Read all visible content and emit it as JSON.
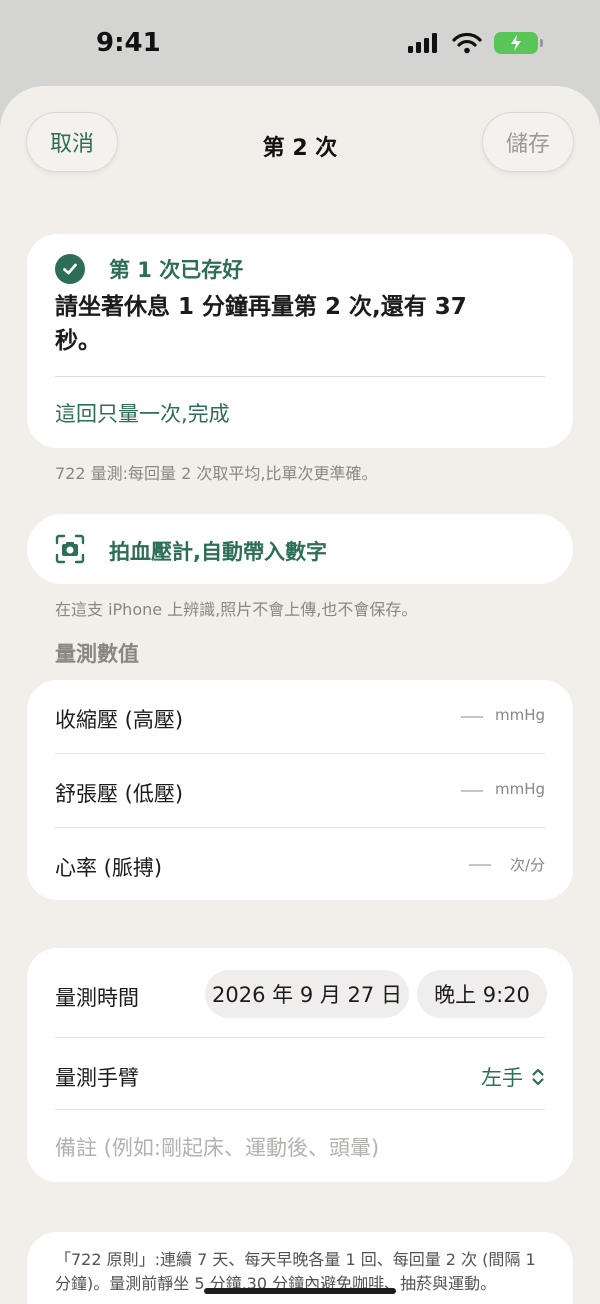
{
  "status_bar": {
    "time": "9:41",
    "icons": [
      "cellular-signal-icon",
      "wifi-icon",
      "battery-charging-icon"
    ]
  },
  "nav": {
    "cancel_label": "取消",
    "title": "第 2 次",
    "save_label": "儲存"
  },
  "saved_card": {
    "status_label": "第 1 次已存好",
    "message": "請坐著休息 1 分鐘再量第 2 次,還有 37 秒。",
    "single_measure_link": "這回只量一次,完成"
  },
  "hint_722": "722 量測:每回量 2 次取平均,比單次更準確。",
  "camera": {
    "label": "拍血壓計,自動帶入數字",
    "hint": "在這支 iPhone 上辨識,照片不會上傳,也不會保存。"
  },
  "values_section": {
    "heading": "量測數值",
    "rows": [
      {
        "label": "收縮壓 (高壓)",
        "value": "",
        "unit": "mmHg"
      },
      {
        "label": "舒張壓 (低壓)",
        "value": "",
        "unit": "mmHg"
      },
      {
        "label": "心率 (脈搏)",
        "value": "",
        "unit": "次/分"
      }
    ]
  },
  "details": {
    "time_label": "量測時間",
    "date": "2026 年 9 月 27 日",
    "time": "晚上 9:20",
    "arm_label": "量測手臂",
    "arm_value": "左手",
    "note_placeholder": "備註 (例如:剛起床、運動後、頭暈)"
  },
  "rule_note": "「722 原則」:連續 7 天、每天早晚各量 1 回、每回量 2 次 (間隔 1 分鐘)。量測前靜坐 5 分鐘,30 分鐘內避免咖啡、抽菸與運動。",
  "colors": {
    "accent": "#2d6e57",
    "background": "#f2efea",
    "card": "#ffffff",
    "muted": "#8a8782"
  }
}
